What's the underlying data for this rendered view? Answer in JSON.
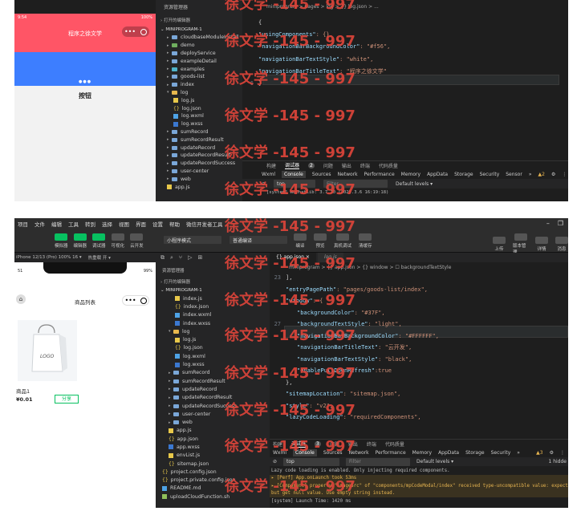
{
  "panel1": {
    "status_time": "9:54",
    "battery": "100%",
    "page_title": "程序之徐文学",
    "button_label": "按钮",
    "explorer_title": "资源管理器",
    "open_editors": "打开的编辑器",
    "project_name": "MINIPROGRAM-1",
    "tree": [
      {
        "label": "cloudbaseModuleInstall",
        "type": "folder",
        "color": "b"
      },
      {
        "label": "demo",
        "type": "folder",
        "color": "g"
      },
      {
        "label": "deployService",
        "type": "folder",
        "color": "b"
      },
      {
        "label": "exampleDetail",
        "type": "folder",
        "color": "b"
      },
      {
        "label": "examples",
        "type": "folder",
        "color": "c"
      },
      {
        "label": "goods-list",
        "type": "folder",
        "color": "b"
      },
      {
        "label": "index",
        "type": "folder",
        "color": "b"
      },
      {
        "label": "log",
        "type": "folder-open",
        "color": "y"
      },
      {
        "label": "log.js",
        "type": "js",
        "indent": 1
      },
      {
        "label": "log.json",
        "type": "json",
        "indent": 1
      },
      {
        "label": "log.wxml",
        "type": "wxml",
        "indent": 1
      },
      {
        "label": "log.wxss",
        "type": "wxss",
        "indent": 1
      },
      {
        "label": "sumRecord",
        "type": "folder",
        "color": "b"
      },
      {
        "label": "sumRecordResult",
        "type": "folder",
        "color": "b"
      },
      {
        "label": "updateRecord",
        "type": "folder",
        "color": "b"
      },
      {
        "label": "updateRecordResult",
        "type": "folder",
        "color": "b"
      },
      {
        "label": "updateRecordSuccess",
        "type": "folder",
        "color": "b"
      },
      {
        "label": "user-center",
        "type": "folder",
        "color": "b"
      },
      {
        "label": "web",
        "type": "folder",
        "color": "b"
      },
      {
        "label": "app.js",
        "type": "js",
        "indent": 0
      }
    ],
    "breadcrumb": "miniprogram > pages > log > {} log.json > ...",
    "code": [
      {
        "n": "",
        "t": "{"
      },
      {
        "n": "",
        "k": "\"usingComponents\"",
        "v": ": {},"
      },
      {
        "n": "",
        "k": "\"navigationBarBackgroundColor\"",
        "v": ": \"#f56\","
      },
      {
        "n": "",
        "k": "\"navigationBarTextStyle\"",
        "v": ": \"white\","
      },
      {
        "n": "",
        "k": "\"navigationBarTitleText\"",
        "v": ": \"程序之徐文学\""
      },
      {
        "n": "6",
        "t": "}"
      }
    ],
    "panel_tabs": [
      "构建",
      "调试器",
      "2",
      "问题",
      "输出",
      "终端",
      "代码质量"
    ],
    "devtool_tabs": [
      "Wxml",
      "Console",
      "Sources",
      "Network",
      "Performance",
      "Memory",
      "AppData",
      "Storage",
      "Security",
      "Sensor",
      "»"
    ],
    "warn_count": "2",
    "context": "top",
    "filter_placeholder": "Filter",
    "levels": "Default levels ▾",
    "console_text": "[system] WeChatLib: 3.7.10 (2025.3.6 16:19:18)"
  },
  "panel2": {
    "menu": [
      "项目",
      "文件",
      "编辑",
      "工具",
      "转到",
      "选择",
      "视图",
      "界面",
      "设置",
      "帮助",
      "微信开发者工具"
    ],
    "toolbar_left": [
      "模拟器",
      "编辑器",
      "调试器",
      "可视化",
      "云开发"
    ],
    "mode_select": "小程序模式",
    "compile_select": "普通编译",
    "toolbar_mid": [
      "编译",
      "预览",
      "真机调试",
      "清缓存"
    ],
    "toolbar_right": [
      "上传",
      "版本管理",
      "详情",
      "消息"
    ],
    "device": "iPhone 12/13 (Pro) 100% 16 ▾",
    "hot_reload": "热重载 开 ▾",
    "status_time": "51",
    "battery": "99%",
    "page_title": "商品列表",
    "product_name": "商品1",
    "product_price": "¥0.01",
    "share_label": "分享",
    "image_logo": "LOGO",
    "explorer_title": "资源管理器",
    "open_editors": "打开的编辑器",
    "project_name": "MINIPROGRAM-1",
    "tree": [
      {
        "label": "index.js",
        "type": "js",
        "indent": 1
      },
      {
        "label": "index.json",
        "type": "json",
        "indent": 1
      },
      {
        "label": "index.wxml",
        "type": "wxml",
        "indent": 1
      },
      {
        "label": "index.wxss",
        "type": "wxss",
        "indent": 1
      },
      {
        "label": "log",
        "type": "folder-open",
        "color": "y"
      },
      {
        "label": "log.js",
        "type": "js",
        "indent": 1
      },
      {
        "label": "log.json",
        "type": "json",
        "indent": 1
      },
      {
        "label": "log.wxml",
        "type": "wxml",
        "indent": 1
      },
      {
        "label": "log.wxss",
        "type": "wxss",
        "indent": 1
      },
      {
        "label": "sumRecord",
        "type": "folder",
        "color": "b"
      },
      {
        "label": "sumRecordResult",
        "type": "folder",
        "color": "b"
      },
      {
        "label": "updateRecord",
        "type": "folder",
        "color": "b"
      },
      {
        "label": "updateRecordResult",
        "type": "folder",
        "color": "b"
      },
      {
        "label": "updateRecordSuccess",
        "type": "folder",
        "color": "b"
      },
      {
        "label": "user-center",
        "type": "folder",
        "color": "b"
      },
      {
        "label": "web",
        "type": "folder",
        "color": "b"
      },
      {
        "label": "app.js",
        "type": "js",
        "indent": 0
      },
      {
        "label": "app.json",
        "type": "json",
        "indent": 0
      },
      {
        "label": "app.wxss",
        "type": "wxss",
        "indent": 0
      },
      {
        "label": "envList.js",
        "type": "js",
        "indent": 0
      },
      {
        "label": "sitemap.json",
        "type": "json",
        "indent": 0
      },
      {
        "label": "project.config.json",
        "type": "json",
        "indent": -1
      },
      {
        "label": "project.private.config.json",
        "type": "json",
        "indent": -1
      },
      {
        "label": "README.md",
        "type": "md",
        "indent": -1
      },
      {
        "label": "uploadCloudFunction.sh",
        "type": "sh",
        "indent": -1
      }
    ],
    "editor_tabs": [
      "{} app.json ×",
      "log.js"
    ],
    "breadcrumb": "miniprogram > {} app.json > {} window > ☐ backgroundTextStyle",
    "code": [
      {
        "n": "23",
        "t": "],"
      },
      {
        "n": "",
        "k": "\"entryPagePath\"",
        "v": ": \"pages/goods-list/index\","
      },
      {
        "n": "",
        "k": "\"window\"",
        "v": ": {"
      },
      {
        "n": "",
        "k": "\"backgroundColor\"",
        "v": ": \"#37F\",",
        "indent": 1
      },
      {
        "n": "27",
        "k": "\"backgroundTextStyle\"",
        "v": ": \"light\",",
        "indent": 1,
        "hl": true
      },
      {
        "n": "",
        "k": "\"navigationBarBackgroundColor\"",
        "v": ": \"#FFFFFF\",",
        "indent": 1
      },
      {
        "n": "",
        "k": "\"navigationBarTitleText\"",
        "v": ": \"云开发\",",
        "indent": 1
      },
      {
        "n": "",
        "k": "\"navigationBarTextStyle\"",
        "v": ": \"black\",",
        "indent": 1
      },
      {
        "n": "",
        "k": "\"enablePullDownRefresh\"",
        "v": ":true",
        "indent": 1
      },
      {
        "n": "",
        "t": "},"
      },
      {
        "n": "",
        "k": "\"sitemapLocation\"",
        "v": ": \"sitemap.json\","
      },
      {
        "n": "",
        "k": "\"style\"",
        "v": ": \"v2\","
      },
      {
        "n": "",
        "k": "\"lazyCodeLoading\"",
        "v": ": \"requiredComponents\","
      }
    ],
    "panel_tabs": [
      "构建",
      "调试器",
      "3",
      "问题",
      "输出",
      "终端",
      "代码质量"
    ],
    "devtool_tabs": [
      "Wxml",
      "Console",
      "Sources",
      "Network",
      "Performance",
      "Memory",
      "AppData",
      "Storage",
      "Security",
      "»"
    ],
    "warn_count": "3",
    "context": "top",
    "filter_placeholder": "Filter",
    "levels": "Default levels ▾",
    "hidden": "1 hidde",
    "console_lines": [
      {
        "t": "Lazy code loading is enabled. Only injecting required components.",
        "c": "#bbb"
      },
      {
        "t": "▸ [Perf] App.onLaunch took 53ms",
        "c": "#e6b450",
        "warn": true
      },
      {
        "t": "▸ [Component] property \"imageSrc\" of \"components/mpCodeModal/index\" received type-uncompatible value: expected <String>",
        "c": "#e6b450",
        "warn": true
      },
      {
        "t": "  but get null value. Use empty string instead.",
        "c": "#e6b450",
        "warn": true
      },
      {
        "t": "[system] Launch Time: 1420 ms",
        "c": "#bbb"
      }
    ]
  },
  "watermark": "徐文学 -145 - 997",
  "colors": {
    "navbar_red": "#ff5566",
    "banner_blue": "#3d7eff",
    "accent_green": "#07c160"
  }
}
